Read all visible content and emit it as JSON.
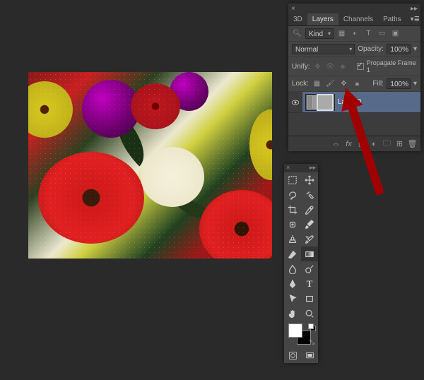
{
  "canvas": {
    "description": "flower-bouquet-photo"
  },
  "layers_panel": {
    "tabs": [
      "3D",
      "Layers",
      "Channels",
      "Paths"
    ],
    "active_tab": "Layers",
    "filter_label": "Kind",
    "blend_mode": "Normal",
    "opacity_label": "Opacity:",
    "opacity_value": "100%",
    "unify_label": "Unify:",
    "propagate_label": "Propagate Frame 1",
    "lock_label": "Lock:",
    "fill_label": "Fill:",
    "fill_value": "100%",
    "layers": [
      {
        "name": "Layer 0",
        "visible": true,
        "type": "smart-object",
        "selected": true
      }
    ],
    "footer_icons": [
      "link",
      "fx",
      "mask",
      "adjustment",
      "group",
      "new",
      "trash"
    ]
  },
  "tools_panel": {
    "tools": [
      "move",
      "rect-marquee",
      "lasso",
      "magic-wand",
      "crop",
      "eyedropper",
      "healing-brush",
      "brush",
      "clone-stamp",
      "history-brush",
      "eraser",
      "gradient",
      "blur",
      "dodge",
      "pen",
      "type",
      "path-select",
      "rectangle",
      "hand",
      "zoom"
    ],
    "fg_color": "#ffffff",
    "bg_color": "#000000"
  }
}
